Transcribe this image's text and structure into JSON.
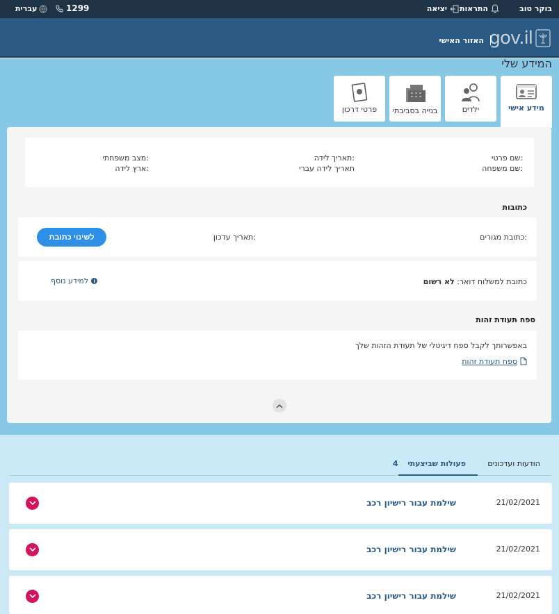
{
  "topbar": {
    "greeting": "בוקר טוב",
    "notifications": "התראות",
    "logout": "יציאה",
    "phone": "1299",
    "language": "עברית"
  },
  "header": {
    "logo_text": "gov.il",
    "personal_area": "האזור האישי"
  },
  "page_title": "המידע שלי",
  "tabs": [
    {
      "label": "מידע אישי",
      "icon": "id-card-icon",
      "active": true
    },
    {
      "label": "ילדים",
      "icon": "children-icon",
      "active": false
    },
    {
      "label": "בנייה בסביבתי",
      "icon": "building-icon",
      "active": false
    },
    {
      "label": "פרטי דרכון",
      "icon": "passport-icon",
      "active": false
    }
  ],
  "personal": {
    "first_name": "שם פרטי:",
    "last_name": "שם משפחה:",
    "birth_date": "תאריך לידה:",
    "hebrew_birth_date": "תאריך לידה עברי",
    "marital_status": "מצב משפחתי:",
    "birth_country": "ארץ לידה:"
  },
  "addresses": {
    "section_title": "כתובות",
    "residence_label": "כתובת מגורים:",
    "update_date_label": "תאריך עדכון:",
    "change_button": "לשינוי כתובת",
    "mail_label": "כתובת למשלוח דואר:",
    "mail_value": "לא רשום",
    "more_info": "למידע נוסף"
  },
  "id_appendix": {
    "section_title": "ספח תעודת זהות",
    "description": "באפשרותך לקבל ספח דיגיטלי של תעודת הזהות שלך",
    "link": "ספח תעודת זהות"
  },
  "lower_tabs": {
    "updates": "הודעות ועדכונים",
    "actions": "פעולות שביצעתי",
    "actions_count": "4"
  },
  "actions": [
    {
      "date": "21/02/2021",
      "title": "שילמת עבור רישיון רכב"
    },
    {
      "date": "21/02/2021",
      "title": "שילמת עבור רישיון רכב"
    },
    {
      "date": "21/02/2021",
      "title": "שילמת עבור רישיון רכב"
    }
  ],
  "colors": {
    "topbar": "#1f3347",
    "header": "#2a5a83",
    "main_bg": "#88c8e7",
    "lower_bg": "#cbeaf8",
    "primary_button": "#2e8fe6",
    "toggle": "#d4145a"
  }
}
